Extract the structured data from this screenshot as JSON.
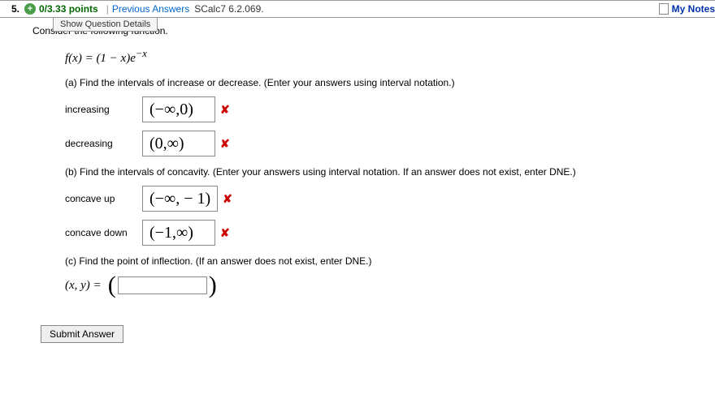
{
  "header": {
    "number": "5.",
    "points": "0/3.33 points",
    "prev": "Previous Answers",
    "ref": "SCalc7 6.2.069.",
    "my_notes": "My Notes",
    "show_details": "Show Question Details"
  },
  "body": {
    "consider": "Consider the following function.",
    "fx_lhs": "f(x) = (1 − x)e",
    "fx_exp": "−x",
    "part_a": "(a) Find the intervals of increase or decrease. (Enter your answers using interval notation.)",
    "increasing_label": "increasing",
    "increasing_val": "(−∞,0)",
    "decreasing_label": "decreasing",
    "decreasing_val": "(0,∞)",
    "part_b": "(b) Find the intervals of concavity. (Enter your answers using interval notation. If an answer does not exist, enter DNE.)",
    "concave_up_label": "concave up",
    "concave_up_val": "(−∞, − 1)",
    "concave_down_label": "concave down",
    "concave_down_val": "(−1,∞)",
    "part_c": "(c) Find the point of inflection. (If an answer does not exist, enter DNE.)",
    "xy": "(x, y) = ",
    "submit": "Submit Answer"
  }
}
